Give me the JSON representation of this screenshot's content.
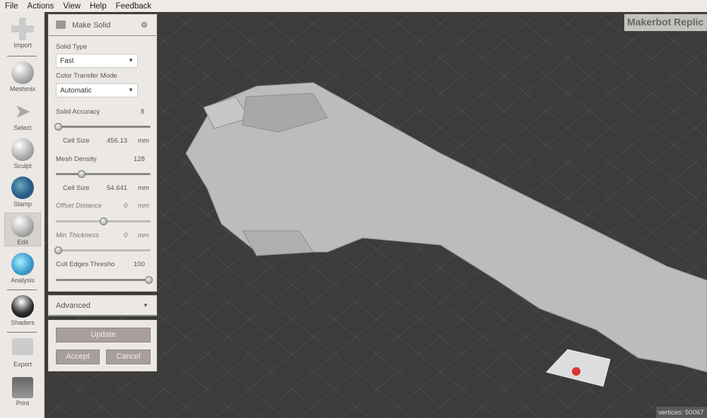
{
  "menu": [
    "File",
    "Actions",
    "View",
    "Help",
    "Feedback"
  ],
  "tools": [
    {
      "label": "Import",
      "icon": "plus-icon"
    },
    {
      "label": "Meshmix",
      "icon": "meshmix-icon"
    },
    {
      "label": "Select",
      "icon": "select-arrow-icon"
    },
    {
      "label": "Sculpt",
      "icon": "sculpt-brush-icon"
    },
    {
      "label": "Stamp",
      "icon": "stamp-icon"
    },
    {
      "label": "Edit",
      "icon": "edit-icon"
    },
    {
      "label": "Analysis",
      "icon": "analysis-icon"
    },
    {
      "label": "Shaders",
      "icon": "shaders-sphere-icon"
    },
    {
      "label": "Export",
      "icon": "export-icon"
    },
    {
      "label": "Print",
      "icon": "print-icon"
    }
  ],
  "panel": {
    "title": "Make Solid",
    "solid_type_label": "Solid Type",
    "solid_type": "Fast",
    "color_mode_label": "Color Transfer Mode",
    "color_mode": "Automatic",
    "solid_accuracy_label": "Solid Accuracy",
    "solid_accuracy": "8",
    "solid_accuracy_frac": 0.02,
    "cell_size_label": "Cell Size",
    "cell_size_1": "456.13",
    "unit": "mm",
    "mesh_density_label": "Mesh Density",
    "mesh_density": "128",
    "mesh_density_frac": 0.27,
    "cell_size_2": "54.641",
    "offset_label": "Offset Distance",
    "offset": "0",
    "offset_frac": 0.5,
    "min_thick_label": "Min Thickness",
    "min_thick": "0",
    "min_thick_frac": 0.02,
    "cull_label": "Cull Edges Thresho",
    "cull": "100",
    "cull_frac": 0.98,
    "advanced": "Advanced",
    "update": "Update",
    "accept": "Accept",
    "cancel": "Cancel"
  },
  "printer_badge": "Makerbot Replic",
  "vertices": "vertices: 50067"
}
